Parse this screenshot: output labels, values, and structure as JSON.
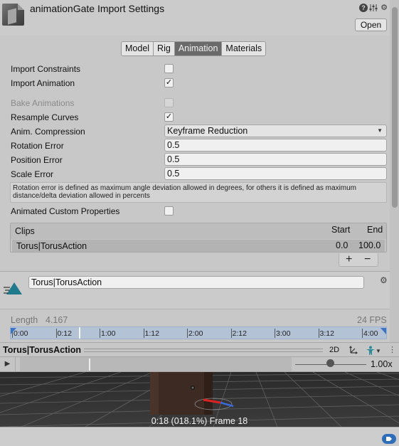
{
  "header": {
    "title": "animationGate Import Settings",
    "help_icon": "?",
    "open_label": "Open"
  },
  "tabs": [
    {
      "label": "Model",
      "active": false
    },
    {
      "label": "Rig",
      "active": false
    },
    {
      "label": "Animation",
      "active": true
    },
    {
      "label": "Materials",
      "active": false
    }
  ],
  "properties": {
    "import_constraints": {
      "label": "Import Constraints",
      "checked": false
    },
    "import_animation": {
      "label": "Import Animation",
      "checked": true
    },
    "bake_animations": {
      "label": "Bake Animations",
      "checked": false,
      "disabled": true
    },
    "resample_curves": {
      "label": "Resample Curves",
      "checked": true
    },
    "anim_compression": {
      "label": "Anim. Compression",
      "value": "Keyframe Reduction"
    },
    "rotation_error": {
      "label": "Rotation Error",
      "value": "0.5"
    },
    "position_error": {
      "label": "Position Error",
      "value": "0.5"
    },
    "scale_error": {
      "label": "Scale Error",
      "value": "0.5"
    },
    "help_text": "Rotation error is defined as maximum angle deviation allowed in degrees, for others it is defined as maximum distance/delta deviation allowed in percents",
    "animated_custom_properties": {
      "label": "Animated Custom Properties",
      "checked": false
    }
  },
  "clips": {
    "title": "Clips",
    "start_header": "Start",
    "end_header": "End",
    "rows": [
      {
        "name": "Torus|TorusAction",
        "start": "0.0",
        "end": "100.0"
      }
    ],
    "add_label": "+",
    "remove_label": "−"
  },
  "clip_detail": {
    "name": "Torus|TorusAction",
    "length_label": "Length",
    "length_value": "4.167",
    "fps": "24 FPS",
    "timeline_ticks": [
      "0:00",
      "0:12",
      "1:00",
      "1:12",
      "2:00",
      "2:12",
      "3:00",
      "3:12",
      "4:00"
    ],
    "playhead_fraction": 0.18
  },
  "preview": {
    "title": "Torus|TorusAction",
    "mode_2d": "2D",
    "speed": "1.00x",
    "frame_label": "0:18 (018.1%) Frame 18"
  },
  "colors": {
    "panel_bg": "#c8c8c8",
    "active_tab": "#6a6a6a",
    "timeline_bg": "#b4c2d6",
    "accent_blue": "#3a74c4",
    "viewport_bg": "#343434"
  },
  "icons": {
    "asset": "model-asset-icon",
    "help": "help-icon",
    "presets": "preset-icon",
    "settings": "gear-icon",
    "clip": "animation-clip-icon",
    "play": "play-icon",
    "avatar": "avatar-icon",
    "tag": "tag-badge-icon"
  }
}
